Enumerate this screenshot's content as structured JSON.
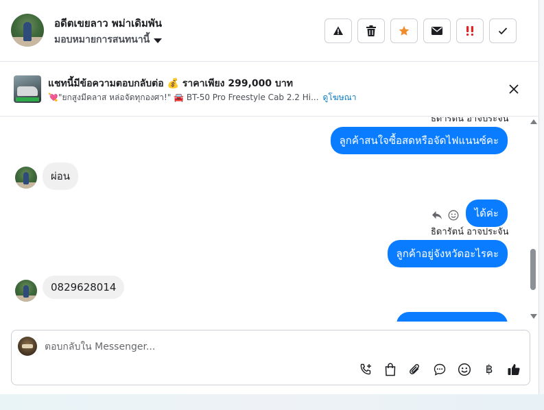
{
  "header": {
    "contact_name": "อดีตเขยลาว พม่าเดิมพัน",
    "assign_label": "มอบหมายการสนทนานี้",
    "actions": [
      {
        "name": "warning-icon"
      },
      {
        "name": "trash-icon"
      },
      {
        "name": "star-icon",
        "color": "#f28b2c"
      },
      {
        "name": "envelope-icon"
      },
      {
        "name": "urgent-icon",
        "color": "#e02424"
      },
      {
        "name": "check-icon"
      }
    ]
  },
  "ad": {
    "title": "แชทนี้มีข้อความตอบกลับต่อ 💰 ราคาเพียง 299,000 บาท",
    "subtitle": "💘\"ยกสูงมีคลาส หล่อจัดทุกองศา!\" 🚘 BT-50 Pro Freestyle Cab 2.2 Hi...",
    "link_label": "ดูโฆษณา"
  },
  "conversation": {
    "top_sender_partial": "ธิดารัตน์ อาจประจัน",
    "messages": [
      {
        "dir": "out",
        "text": "ลูกค้าสนใจซื้อสดหรือจัดไฟแนนซ์คะ"
      },
      {
        "dir": "in",
        "text": "ผ่อน"
      },
      {
        "dir": "out",
        "text": "ได้ค่ะ"
      },
      {
        "dir": "out",
        "sender": "ธิดารัตน์ อาจประจัน",
        "text": "ลูกค้าอยู่จังหวัดอะไรคะ"
      },
      {
        "dir": "in",
        "text": "0829628014"
      }
    ]
  },
  "composer": {
    "placeholder": "ตอบกลับใน Messenger...",
    "baht_symbol": "฿"
  },
  "colors": {
    "outgoing_bubble": "#0a7cff",
    "incoming_bubble": "#f0f0f0",
    "link": "#0a7bc2"
  }
}
